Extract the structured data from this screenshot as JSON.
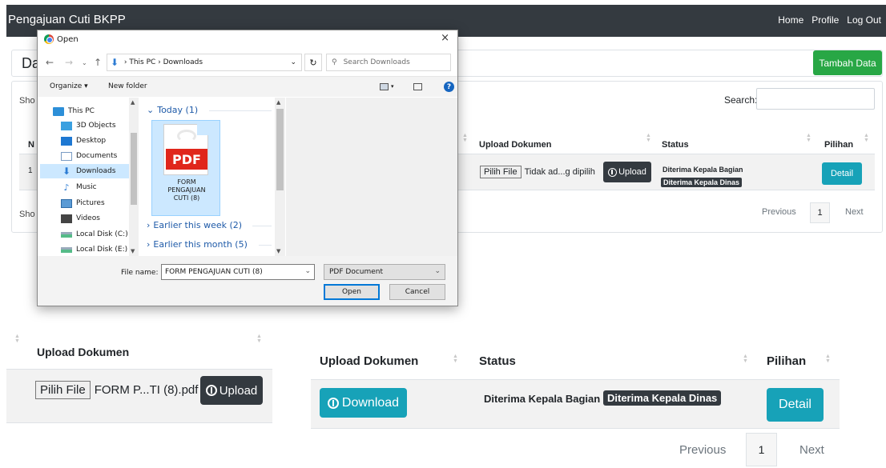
{
  "app": {
    "brand": "Pengajuan Cuti BKPP",
    "nav": [
      "Home",
      "Profile",
      "Log Out"
    ]
  },
  "background": {
    "heading_fragment": "Da",
    "add_button": "Tambah Data",
    "show_top_fragment": "Sho",
    "show_bottom_fragment": "Sho",
    "search_label": "Search:",
    "columns": {
      "no_fragment": "N",
      "upload": "Upload Dokumen",
      "status": "Status",
      "pilihan": "Pilihan"
    },
    "row": {
      "no": "1",
      "file_button": "Pilih File",
      "file_text": "Tidak ad...g dipilih",
      "upload_button": "Upload",
      "status_1": "Diterima Kepala Bagian",
      "status_2": "Diterima Kepala Dinas",
      "detail_button": "Detail"
    },
    "pagination": {
      "previous": "Previous",
      "page": "1",
      "next": "Next"
    }
  },
  "dialog": {
    "title": "Open",
    "close": "×",
    "path": [
      "This PC",
      "Downloads"
    ],
    "search_placeholder": "Search Downloads",
    "toolbar": {
      "organize": "Organize ▾",
      "new_folder": "New folder",
      "help": "?"
    },
    "nav_items": [
      {
        "label": "This PC",
        "icon": "computer-icon"
      },
      {
        "label": "3D Objects",
        "icon": "cube-icon"
      },
      {
        "label": "Desktop",
        "icon": "desktop-icon"
      },
      {
        "label": "Documents",
        "icon": "document-icon"
      },
      {
        "label": "Downloads",
        "icon": "download-arrow-icon",
        "selected": true
      },
      {
        "label": "Music",
        "icon": "music-icon"
      },
      {
        "label": "Pictures",
        "icon": "picture-icon"
      },
      {
        "label": "Videos",
        "icon": "video-icon"
      },
      {
        "label": "Local Disk (C:)",
        "icon": "disk-icon"
      },
      {
        "label": "Local Disk (E:)",
        "icon": "disk-icon"
      }
    ],
    "groups": {
      "today": "Today (1)",
      "earlier_week": "Earlier this week (2)",
      "earlier_month": "Earlier this month (5)"
    },
    "file": {
      "badge": "PDF",
      "name_line1": "FORM",
      "name_line2": "PENGAJUAN",
      "name_line3": "CUTI (8)"
    },
    "file_name_label": "File name:",
    "file_name_value": "FORM PENGAJUAN CUTI (8)",
    "file_type": "PDF Document",
    "open_button": "Open",
    "cancel_button": "Cancel"
  },
  "zoom_left": {
    "header": "Upload Dokumen",
    "file_button": "Pilih File",
    "file_text": "FORM P...TI (8).pdf",
    "upload_button": "Upload"
  },
  "zoom_right": {
    "header_upload": "Upload Dokumen",
    "header_status": "Status",
    "header_pilihan": "Pilihan",
    "download_button": "Download",
    "status_1": "Diterima Kepala Bagian",
    "status_2": "Diterima Kepala Dinas",
    "detail_button": "Detail",
    "pagination": {
      "previous": "Previous",
      "page": "1",
      "next": "Next"
    }
  },
  "colors": {
    "navbar": "#343a40",
    "success": "#28a745",
    "info": "#17a2b8",
    "dark": "#343a40",
    "pdf_red": "#e0261b",
    "selection": "#cce8ff"
  }
}
